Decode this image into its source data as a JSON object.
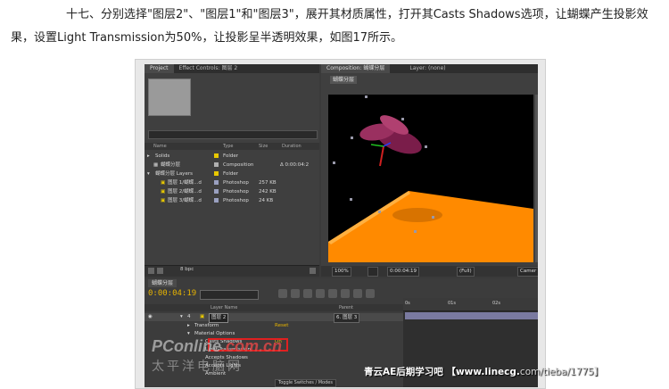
{
  "article": {
    "text": "十七、分别选择\"图层2\"、\"图层1\"和\"图层3\"，展开其材质属性，打开其Casts Shadows选项，让蝴蝶产生投影效果，设置Light Transmission为50%，让投影呈半透明效果，如图17所示。"
  },
  "project_panel": {
    "tab_project": "Project",
    "tab_effect_controls": "Effect Controls: 图层 2",
    "columns": {
      "name": "Name",
      "type": "Type",
      "size": "Size",
      "duration": "Duration"
    },
    "rows": [
      {
        "name": "Solids",
        "type": "Folder",
        "size": "",
        "duration": "",
        "color": "#e8c800"
      },
      {
        "name": "蝴蝶分层",
        "type": "Composition",
        "size": "",
        "duration": "Δ 0:00:04:2",
        "color": "#b0b0b0"
      },
      {
        "name": "蝴蝶分层 Layers",
        "type": "Folder",
        "size": "",
        "duration": "",
        "color": "#e8c800"
      },
      {
        "name": "图层 1/蝴蝶...d",
        "type": "Photoshop",
        "size": "257 KB",
        "duration": "",
        "color": "#9aa0c0"
      },
      {
        "name": "图层 2/蝴蝶...d",
        "type": "Photoshop",
        "size": "242 KB",
        "duration": "",
        "color": "#9aa0c0"
      },
      {
        "name": "图层 3/蝴蝶...d",
        "type": "Photoshop",
        "size": "24 KB",
        "duration": "",
        "color": "#9aa0c0"
      }
    ],
    "bpc": "8 bpc"
  },
  "comp_panel": {
    "tab_composition": "Composition: 蝴蝶分层",
    "tab_layer": "Layer: (none)",
    "comp_tab_label": "蝴蝶分层",
    "zoom": "100%",
    "timecode": "0:00:04:19",
    "resolution": "(Full)",
    "camera": "Camer"
  },
  "timeline": {
    "tab": "蝴蝶分层",
    "current_time": "0:00:04:19",
    "col_layer_name": "Layer Name",
    "col_parent": "Parent",
    "layer_number": "4",
    "layer_name": "图层 2",
    "parent_value": "6. 图层 3",
    "props": [
      {
        "label": "Transform",
        "value": "Reset"
      },
      {
        "label": "Material Options",
        "value": ""
      },
      {
        "label": "Casts Shadows",
        "value": "On"
      },
      {
        "label": "Light Transmission",
        "value": ""
      },
      {
        "label": "Accepts Shadows",
        "value": ""
      },
      {
        "label": "Accepts Lights",
        "value": ""
      },
      {
        "label": "Ambient",
        "value": ""
      }
    ],
    "ruler_ticks": [
      "0s",
      "01s",
      "02s"
    ],
    "toggle_label": "Toggle Switches / Modes"
  },
  "watermarks": {
    "pconline_prefix": "PC",
    "pconline_mid": "online",
    "pconline_suffix": ".com.cn",
    "pconline_cn": "太平洋电脑网",
    "linecg_name": "青云AE后期学习吧",
    "linecg_url": "【www.linecg.",
    "linecg_tail": "com/tieba/1775】"
  },
  "colors": {
    "ae_bg": "#3a3a3a",
    "timecode": "#e8b400",
    "floor": "#ff8a00",
    "highlight_box": "#e02020"
  }
}
